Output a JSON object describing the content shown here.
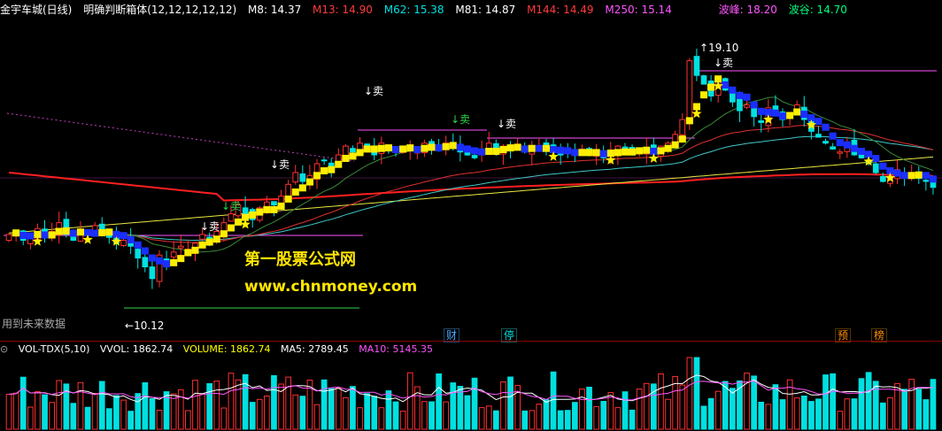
{
  "header": {
    "stock": "金宇车城(日线)",
    "indicator": "明确判断箱体(12,12,12,12,12)",
    "mas": [
      {
        "label": "M8: 14.37",
        "color": "#ffffff"
      },
      {
        "label": "M13: 14.90",
        "color": "#ff3b3b"
      },
      {
        "label": "M62: 15.38",
        "color": "#00e0e0"
      },
      {
        "label": "M81: 14.87",
        "color": "#ffffff"
      },
      {
        "label": "M144: 14.49",
        "color": "#ff3b3b"
      },
      {
        "label": "M250: 15.14",
        "color": "#ff55ff"
      }
    ],
    "peak": "波峰: 18.20",
    "trough": "波谷: 14.70",
    "colors": {
      "stock": "#ffffff",
      "indicator": "#ffffff",
      "peak": "#ff55ff",
      "trough": "#00ff7f"
    }
  },
  "annotations": {
    "high_label": "19.10",
    "low_label": "10.12",
    "future_data_note": "用到未来数据",
    "sell_labels": [
      "↓卖",
      "↓卖",
      "↓卖",
      "↓卖",
      "↓卖"
    ],
    "green_sell_labels": [
      "↓卖",
      "↓卖"
    ]
  },
  "watermark": {
    "line1": "第一股票公式网",
    "line2": "www.chnmoney.com"
  },
  "event_tags": [
    {
      "text": "财",
      "color": "#4aa8ff"
    },
    {
      "text": "停",
      "color": "#00e0e0"
    },
    {
      "text": "预",
      "color": "#ff8c00"
    },
    {
      "text": "榜",
      "color": "#ff8c00"
    }
  ],
  "volume_header": {
    "title": "VOL-TDX(5,10)",
    "vvol": "VVOL: 1862.74",
    "volume": "VOLUME: 1862.74",
    "ma5": "MA5: 2789.45",
    "ma10": "MA10: 5145.35",
    "colors": {
      "title": "#ffffff",
      "vvol": "#ffffff",
      "volume": "#ffff00",
      "ma5": "#ffffff",
      "ma10": "#ff55ff"
    }
  },
  "chart_data": {
    "type": "candlestick",
    "title": "",
    "price_range": [
      9.4,
      19.8
    ],
    "annotated_high": 19.1,
    "annotated_low": 10.12,
    "close": [
      12.5,
      12.6,
      12.3,
      12.4,
      12.7,
      12.4,
      12.6,
      12.9,
      12.5,
      12.3,
      12.6,
      12.5,
      12.8,
      12.6,
      12.4,
      12.2,
      12.3,
      12.1,
      11.7,
      11.4,
      11.0,
      11.8,
      11.6,
      11.9,
      12.1,
      12.0,
      12.2,
      12.5,
      12.4,
      12.6,
      12.9,
      13.2,
      13.5,
      13.2,
      13.0,
      13.4,
      13.6,
      13.5,
      13.8,
      14.2,
      14.6,
      14.3,
      14.5,
      14.9,
      15.0,
      14.8,
      15.2,
      15.5,
      15.3,
      15.6,
      15.4,
      15.2,
      15.6,
      15.4,
      15.3,
      15.5,
      15.4,
      15.3,
      15.6,
      15.5,
      15.4,
      15.6,
      15.5,
      15.3,
      15.2,
      15.1,
      15.4,
      15.6,
      15.3,
      15.5,
      15.4,
      15.5,
      15.3,
      15.4,
      15.5,
      15.4,
      15.3,
      15.2,
      15.3,
      15.2,
      15.4,
      15.3,
      15.2,
      15.1,
      15.3,
      15.5,
      15.4,
      15.2,
      15.3,
      15.4,
      15.3,
      15.5,
      15.6,
      15.9,
      16.4,
      18.4,
      17.9,
      17.6,
      17.2,
      17.8,
      17.4,
      17.0,
      16.7,
      16.9,
      16.5,
      16.3,
      16.8,
      16.6,
      16.4,
      16.6,
      16.9,
      16.4,
      16.0,
      15.8,
      15.6,
      15.4,
      15.3,
      15.6,
      15.2,
      15.1,
      14.9,
      14.6,
      14.3,
      14.4,
      14.7,
      14.5,
      14.6,
      14.4,
      14.3,
      14.1
    ],
    "ma_lines": [
      "M8",
      "M13",
      "M62",
      "M81",
      "M144",
      "M250"
    ],
    "volume_ma_lines": [
      "MA5",
      "MA10"
    ],
    "grid": false,
    "legend_placement": "top"
  }
}
